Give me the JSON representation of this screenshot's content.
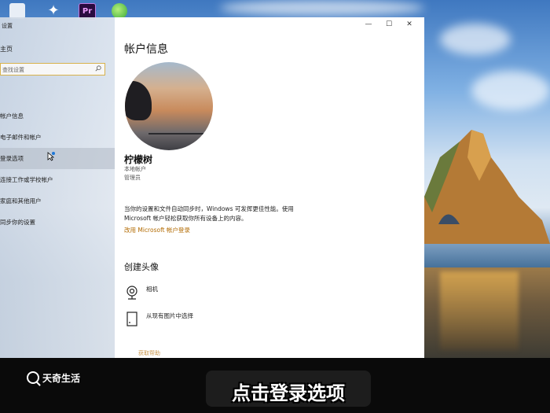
{
  "window": {
    "app_title": "设置",
    "controls": {
      "minimize": "—",
      "maximize": "☐",
      "close": "✕"
    }
  },
  "sidebar": {
    "home_label": "主页",
    "search_placeholder": "查找设置",
    "items": [
      {
        "label": "帐户信息"
      },
      {
        "label": "电子邮件和帐户"
      },
      {
        "label": "登录选项"
      },
      {
        "label": "连接工作或学校帐户"
      },
      {
        "label": "家庭和其他用户"
      },
      {
        "label": "同步你的设置"
      }
    ],
    "active_index": 2
  },
  "main": {
    "page_title": "帐户信息",
    "user_name": "柠檬树",
    "account_type": "本地帐户",
    "role": "管理员",
    "description": "当你的设置和文件自动同步时，Windows 可发挥更佳性能。使用 Microsoft 帐户轻松获取你所有设备上的内容。",
    "ms_link": "改用 Microsoft 帐户登录",
    "avatar_section_title": "创建头像",
    "avatar_options": [
      {
        "label": "相机",
        "icon": "webcam-icon"
      },
      {
        "label": "从现有图片中选择",
        "icon": "picture-file-icon"
      }
    ],
    "truncated_link": "获取帮助"
  },
  "overlay": {
    "watermark": "天奇生活",
    "caption": "点击登录选项"
  },
  "colors": {
    "link": "#b26a00",
    "search_border": "#d8b24c",
    "content_bg": "#ffffff"
  }
}
